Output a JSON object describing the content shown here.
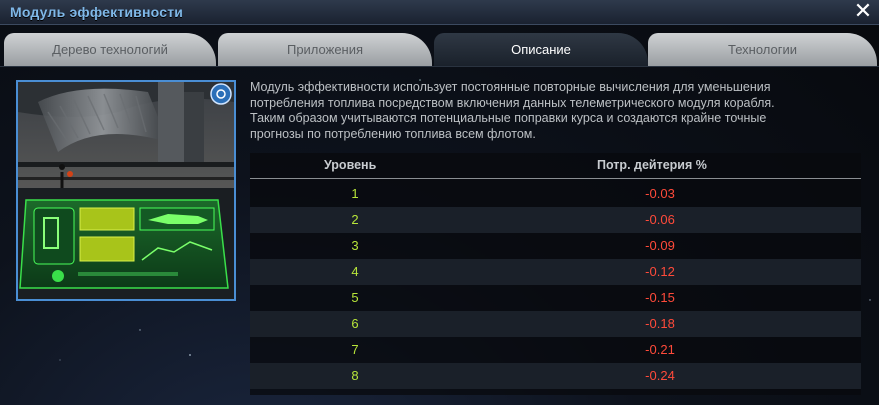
{
  "window": {
    "title": "Модуль эффективности",
    "close_icon": "close-icon"
  },
  "tabs": [
    {
      "label": "Дерево технологий",
      "active": false
    },
    {
      "label": "Приложения",
      "active": false
    },
    {
      "label": "Описание",
      "active": true
    },
    {
      "label": "Технологии",
      "active": false
    }
  ],
  "description": {
    "lines": [
      "Модуль эффективности использует постоянные повторные вычисления для уменьшения",
      "потребления топлива посредством включения данных телеметрического модуля корабля.",
      "Таким образом учитываются потенциальные поправки курса и создаются крайне точные",
      "прогнозы по потреблению топлива всем флотом."
    ]
  },
  "table": {
    "headers": {
      "level": "Уровень",
      "value": "Потр. дейтерия %"
    },
    "rows": [
      {
        "level": "1",
        "value": "-0.03"
      },
      {
        "level": "2",
        "value": "-0.06"
      },
      {
        "level": "3",
        "value": "-0.09"
      },
      {
        "level": "4",
        "value": "-0.12"
      },
      {
        "level": "5",
        "value": "-0.15"
      },
      {
        "level": "6",
        "value": "-0.18"
      },
      {
        "level": "7",
        "value": "-0.21"
      },
      {
        "level": "8",
        "value": "-0.24"
      }
    ]
  },
  "colors": {
    "title": "#7fb8e8",
    "level_text": "#b8e63a",
    "value_text": "#ff4a3a",
    "frame_border": "#4a8ed4"
  }
}
